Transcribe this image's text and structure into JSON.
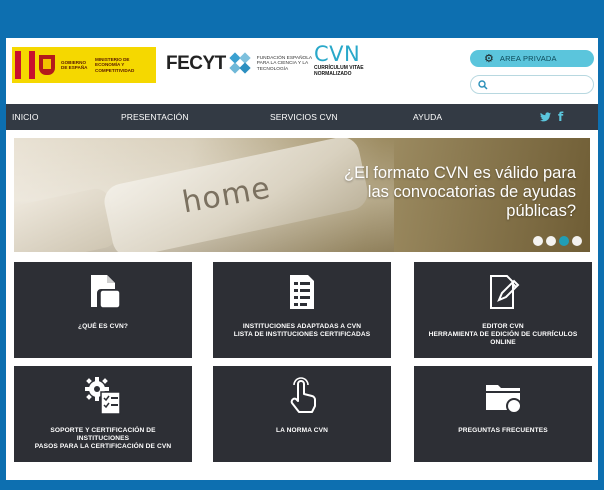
{
  "header": {
    "gov_logo_text_1": "GOBIERNO DE ESPAÑA",
    "gov_logo_text_2": "MINISTERIO DE ECONOMÍA Y COMPETITIVIDAD",
    "fecyt_name": "FECYT",
    "fecyt_subtitle": "FUNDACIÓN ESPAÑOLA PARA LA CIENCIA Y LA TECNOLOGÍA",
    "cvn_name": "CVN",
    "cvn_subtitle": "CURRÍCULUM VITAE NORMALIZADO",
    "area_privada_label": "AREA PRIVADA",
    "search_placeholder": ""
  },
  "nav": {
    "items": [
      {
        "label": "INICIO"
      },
      {
        "label": "PRESENTACIÓN"
      },
      {
        "label": "SERVICIOS CVN"
      },
      {
        "label": "AYUDA"
      }
    ],
    "social": {
      "twitter_icon": "twitter-icon",
      "facebook_label": "f"
    }
  },
  "banner": {
    "image_word": "home",
    "claim": "¿El formato CVN es válido para las convocatorias de ayudas públicas?",
    "slides": 4,
    "active_slide": 3
  },
  "tiles": [
    {
      "icon": "document-icon",
      "line1": "¿QUÉ ES CVN?"
    },
    {
      "icon": "checklist-icon",
      "line1": "INSTITUCIONES ADAPTADAS A CVN",
      "line2": "LISTA DE INSTITUCIONES CERTIFICADAS"
    },
    {
      "icon": "edit-document-icon",
      "line1": "EDITOR CVN",
      "line2": "HERRAMIENTA DE EDICIÓN DE CURRÍCULOS",
      "line3": "ONLINE"
    },
    {
      "icon": "gear-checklist-icon",
      "line1": "SOPORTE Y CERTIFICACIÓN DE",
      "line2": "INSTITUCIONES",
      "line3": "PASOS PARA LA CERTIFICACIÓN DE CVN"
    },
    {
      "icon": "pointer-hand-icon",
      "line1": "LA NORMA CVN"
    },
    {
      "icon": "folder-icon",
      "line1": "PREGUNTAS FRECUENTES"
    }
  ],
  "colors": {
    "frame": "#0d6fb0",
    "nav": "#333a44",
    "tile": "#2d2f35",
    "accent": "#5bc5dc",
    "active_dot": "#1aa3c0"
  }
}
